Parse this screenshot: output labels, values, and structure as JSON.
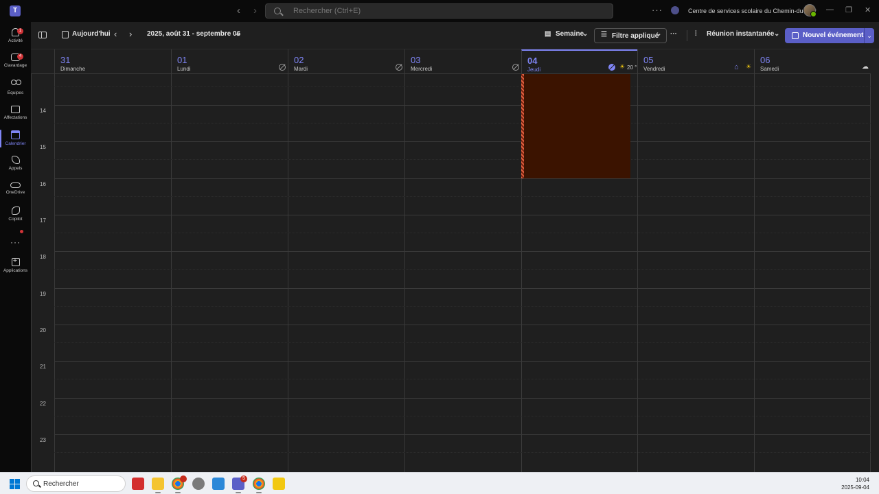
{
  "titlebar": {
    "search_placeholder": "Rechercher (Ctrl+E)",
    "more_label": "···",
    "organization": "Centre de services scolaire du Chemin-du-Roy",
    "back_label": "‹",
    "forward_label": "›",
    "minimize_label": "—",
    "restore_label": "❐",
    "close_label": "✕"
  },
  "rail": {
    "items": [
      {
        "label": "Activité",
        "icon": "bell-icon",
        "badge": "1"
      },
      {
        "label": "Clavardage",
        "icon": "chat-icon",
        "badge": "4"
      },
      {
        "label": "Équipes",
        "icon": "teams-icon",
        "badge": ""
      },
      {
        "label": "Affectations",
        "icon": "assignments-icon",
        "badge": ""
      },
      {
        "label": "Calendrier",
        "icon": "calendar-icon",
        "badge": ""
      },
      {
        "label": "Appels",
        "icon": "phone-icon",
        "badge": ""
      },
      {
        "label": "OneDrive",
        "icon": "cloud-icon",
        "badge": ""
      },
      {
        "label": "Copilot",
        "icon": "copilot-icon",
        "badge": ""
      }
    ],
    "more_label": "···",
    "apps_label": "Applications"
  },
  "toolbar": {
    "today_label": "Aujourd'hui",
    "date_range": "2025, août 31 - septembre 06",
    "view_label": "Semaine",
    "filter_label": "Filtre appliqué",
    "more_label": "···",
    "meet_now_label": "Réunion instantanée",
    "new_event_label": "Nouvel événement"
  },
  "calendar": {
    "days": [
      {
        "num": "31",
        "name": "Dimanche"
      },
      {
        "num": "01",
        "name": "Lundi"
      },
      {
        "num": "02",
        "name": "Mardi"
      },
      {
        "num": "03",
        "name": "Mercredi"
      },
      {
        "num": "04",
        "name": "Jeudi"
      },
      {
        "num": "05",
        "name": "Vendredi"
      },
      {
        "num": "06",
        "name": "Samedi"
      }
    ],
    "today_temperature": "20 °",
    "hours": [
      "14",
      "15",
      "16",
      "17",
      "18",
      "19",
      "20",
      "21",
      "22",
      "23"
    ]
  },
  "taskbar": {
    "search_label": "Rechercher",
    "chrome_badge": "5",
    "teams_badge": "5",
    "time": "10:04",
    "date": "2025-09-04"
  },
  "colors": {
    "accent": "#7f85f5",
    "brand": "#5b5fc7",
    "busy_block": "#3b1300",
    "busy_stripe": "#c44a2a"
  }
}
